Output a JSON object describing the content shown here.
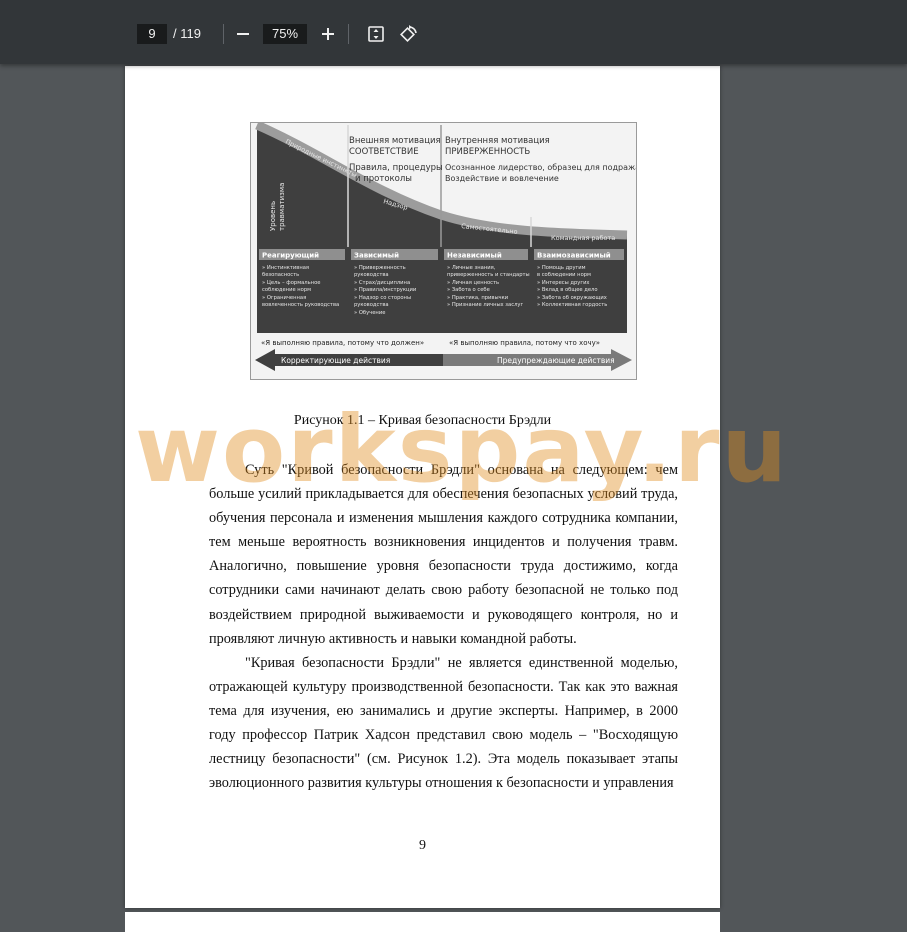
{
  "toolbar": {
    "page_current": "9",
    "page_total": "/ 119",
    "zoom": "75%",
    "zoom_out_icon": "minus-icon",
    "zoom_in_icon": "plus-icon",
    "fit_icon": "fit-page-icon",
    "rotate_icon": "rotate-icon"
  },
  "figure": {
    "header_col2_line1": "Внешняя мотивация",
    "header_col2_line2": "СООТВЕТСТВИЕ",
    "header_col2_line3": "Правила, процедуры",
    "header_col2_line4": "и протоколы",
    "header_col3_line1": "Внутренняя мотивация",
    "header_col3_line2": "ПРИВЕРЖЕННОСТЬ",
    "header_col3_line3": "Осознанное лидерство, образец для подражания",
    "header_col3_line4": "Воздействие и вовлечение",
    "curve_label_1": "Природные инстинкты",
    "curve_label_2": "Надзор",
    "curve_label_3": "Самостоятельно",
    "curve_label_4": "Командная работа",
    "side_label_1": "Уровень",
    "side_label_2": "травматизма",
    "stages": [
      {
        "title": "Реагирующий",
        "items": [
          "» Инстинктивная",
          "  безопасность",
          "» Цель – формальное",
          "  соблюдение норм",
          "» Ограниченная",
          "  вовлеченность руководства"
        ]
      },
      {
        "title": "Зависимый",
        "items": [
          "» Приверженность",
          "  руководства",
          "» Страх/дисциплина",
          "» Правила/инструкции",
          "» Надзор со стороны",
          "  руководства",
          "» Обучение"
        ]
      },
      {
        "title": "Независимый",
        "items": [
          "» Личные знания,",
          "  приверженность и стандарты",
          "» Личная ценность",
          "» Забота о себе",
          "» Практика, привычки",
          "» Признание личных заслуг"
        ]
      },
      {
        "title": "Взаимозависимый",
        "items": [
          "» Помощь другим",
          "  в соблюдении норм",
          "» Интересы других",
          "» Вклад в общее дело",
          "» Забота об окружающих",
          "» Коллективная гордость"
        ]
      }
    ],
    "quote_left": "«Я выполняю правила, потому что должен»",
    "quote_right": "«Я выполняю правила, потому что хочу»",
    "arrow_left": "Корректирующие действия",
    "arrow_right": "Предупреждающие действия"
  },
  "document": {
    "caption": "Рисунок 1.1 – Кривая безопасности Брэдли",
    "paragraph1": "Суть \"Кривой безопасности Брэдли\" основана на следующем: чем больше усилий прикладывается для обеспечения безопасных условий труда, обучения персонала и изменения мышления каждого сотрудника компании, тем меньше вероятность возникновения инцидентов и получения травм. Аналогично, повышение уровня безопасности труда достижимо, когда сотрудники сами начинают делать свою работу безопасной не только под воздействием природной выживаемости и руководящего контроля, но и проявляют личную активность и навыки командной работы.",
    "paragraph2": "\"Кривая безопасности Брэдли\" не является единственной моделью, отражающей культуру производственной безопасности. Так как это важная тема для изучения, ею занимались и другие эксперты. Например, в 2000 году профессор Патрик Хадсон представил свою модель – \"Восходящую лестницу безопасности\" (см. Рисунок 1.2). Эта модель показывает этапы эволюционного развития культуры отношения к безопасности и управления",
    "page_number": "9"
  },
  "watermark": "workspay.ru"
}
